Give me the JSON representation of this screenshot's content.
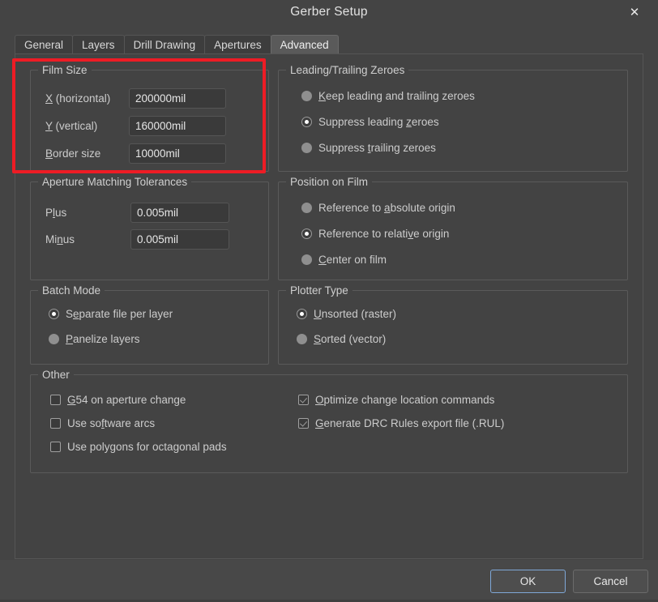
{
  "window": {
    "title": "Gerber Setup",
    "close_icon": "close-icon",
    "close_glyph": "✕"
  },
  "tabs": [
    {
      "label": "General",
      "selected": false
    },
    {
      "label": "Layers",
      "selected": false
    },
    {
      "label": "Drill Drawing",
      "selected": false
    },
    {
      "label": "Apertures",
      "selected": false
    },
    {
      "label": "Advanced",
      "selected": true
    }
  ],
  "groups": {
    "film_size": {
      "title": "Film Size",
      "fields": [
        {
          "label_pre": "",
          "label_key": "X",
          "label_post": " (horizontal)",
          "value": "200000mil"
        },
        {
          "label_pre": "",
          "label_key": "Y",
          "label_post": " (vertical)",
          "value": "160000mil"
        },
        {
          "label_pre": "",
          "label_key": "B",
          "label_post": "order size",
          "value": "10000mil"
        }
      ]
    },
    "aperture_tolerances": {
      "title": "Aperture Matching Tolerances",
      "fields": [
        {
          "label_pre": "P",
          "label_key": "l",
          "label_post": "us",
          "value": "0.005mil"
        },
        {
          "label_pre": "Mi",
          "label_key": "n",
          "label_post": "us",
          "value": "0.005mil"
        }
      ]
    },
    "zeroes": {
      "title": "Leading/Trailing Zeroes",
      "options": [
        {
          "pre": "",
          "key": "K",
          "post": "eep leading and trailing zeroes",
          "checked": false
        },
        {
          "pre": "Suppress leading ",
          "key": "z",
          "post": "eroes",
          "checked": true
        },
        {
          "pre": "Suppress ",
          "key": "t",
          "post": "railing zeroes",
          "checked": false
        }
      ]
    },
    "position": {
      "title": "Position on Film",
      "options": [
        {
          "pre": "Reference to ",
          "key": "a",
          "post": "bsolute origin",
          "checked": false
        },
        {
          "pre": "Reference to relati",
          "key": "v",
          "post": "e origin",
          "checked": true
        },
        {
          "pre": "",
          "key": "C",
          "post": "enter on film",
          "checked": false
        }
      ]
    },
    "batch_mode": {
      "title": "Batch Mode",
      "options": [
        {
          "pre": "S",
          "key": "e",
          "post": "parate file per layer",
          "checked": true
        },
        {
          "pre": "",
          "key": "P",
          "post": "anelize layers",
          "checked": false
        }
      ]
    },
    "plotter_type": {
      "title": "Plotter Type",
      "options": [
        {
          "pre": "",
          "key": "U",
          "post": "nsorted (raster)",
          "checked": true
        },
        {
          "pre": "",
          "key": "S",
          "post": "orted (vector)",
          "checked": false
        }
      ]
    },
    "other": {
      "title": "Other",
      "left_options": [
        {
          "pre": "",
          "key": "G",
          "post": "54 on aperture change",
          "checked": false
        },
        {
          "pre": "Use so",
          "key": "f",
          "post": "tware arcs",
          "checked": false
        },
        {
          "pre": "Use polygons for octagonal pads",
          "key": "",
          "post": "",
          "checked": false
        }
      ],
      "right_options": [
        {
          "pre": "",
          "key": "O",
          "post": "ptimize change location commands",
          "checked": true
        },
        {
          "pre": "",
          "key": "G",
          "post": "enerate DRC Rules export file (.RUL)",
          "checked": true
        }
      ]
    }
  },
  "footer": {
    "ok_label": "OK",
    "cancel_label": "Cancel"
  },
  "annotation": {
    "highlight_color": "#ee1c25",
    "target": "Film Size"
  }
}
